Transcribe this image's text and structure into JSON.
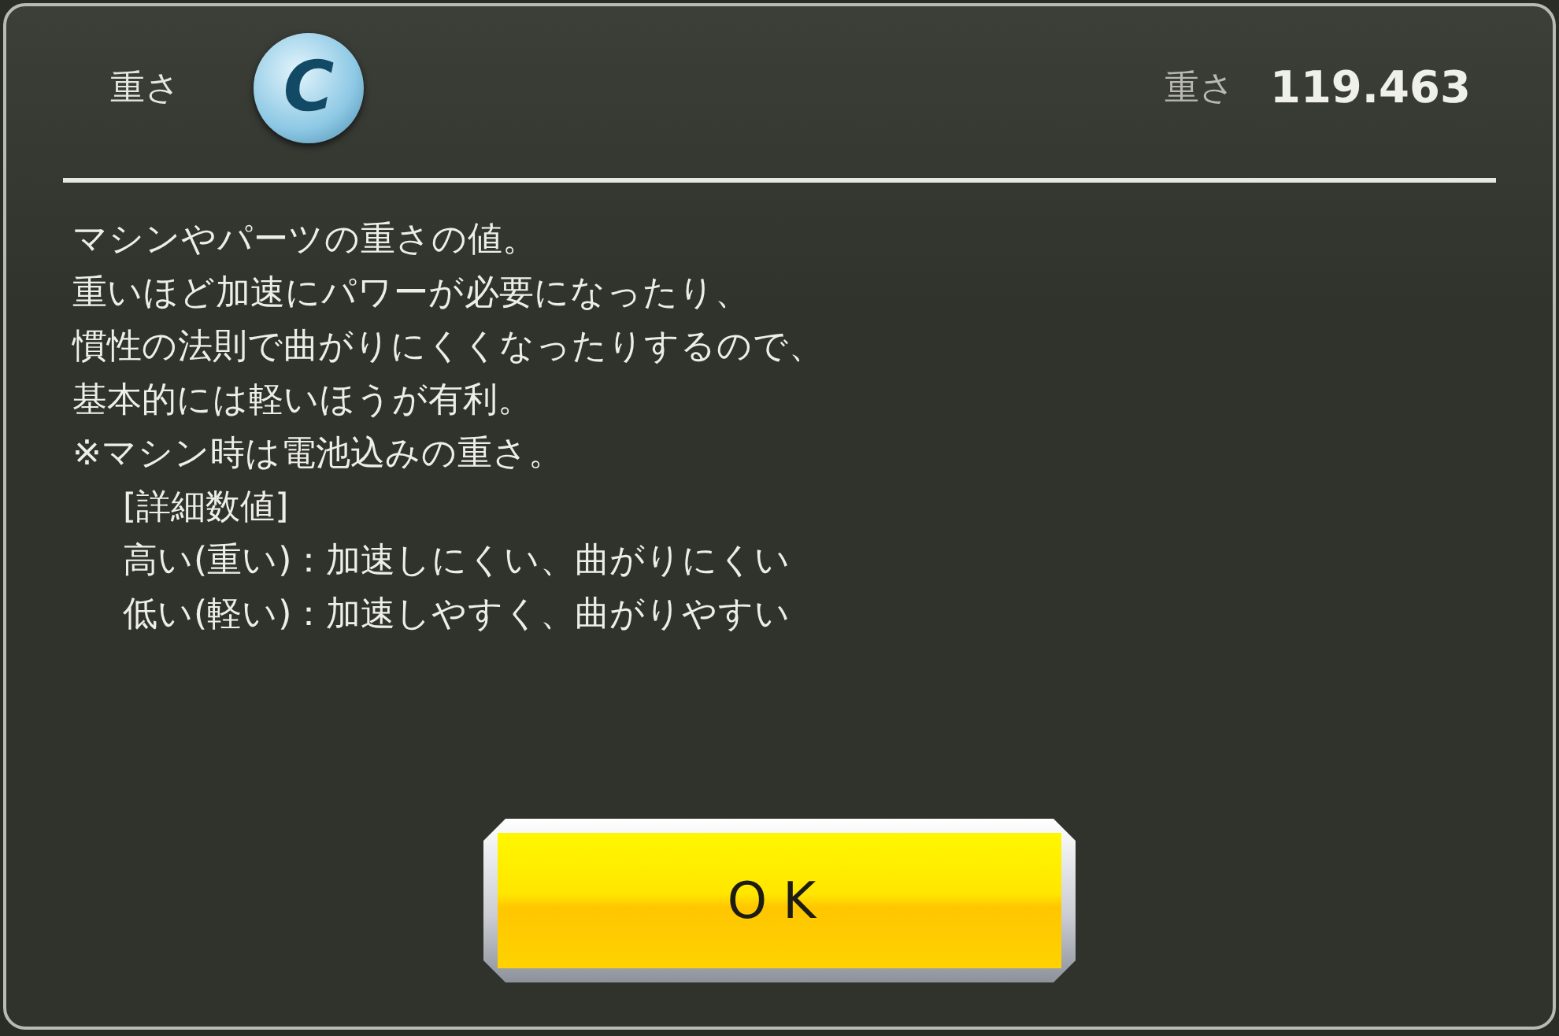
{
  "header": {
    "label": "重さ",
    "grade": "C",
    "stat_label": "重さ",
    "stat_value": "119.463"
  },
  "description": [
    {
      "kind": "plain",
      "text": "マシンやパーツの重さの値。"
    },
    {
      "kind": "plain",
      "text": "重いほど加速にパワーが必要になったり、"
    },
    {
      "kind": "plain",
      "text": "慣性の法則で曲がりにくくなったりするので、"
    },
    {
      "kind": "plain",
      "text": "基本的には軽いほうが有利。"
    },
    {
      "kind": "plain",
      "text": "※マシン時は電池込みの重さ。"
    },
    {
      "kind": "indented",
      "text": "[詳細数値]"
    },
    {
      "kind": "indented",
      "text": "高い(重い)：加速しにくい、曲がりにくい"
    },
    {
      "kind": "indented",
      "text": "低い(軽い)：加速しやすく、曲がりやすい"
    }
  ],
  "buttons": [
    "OK"
  ]
}
